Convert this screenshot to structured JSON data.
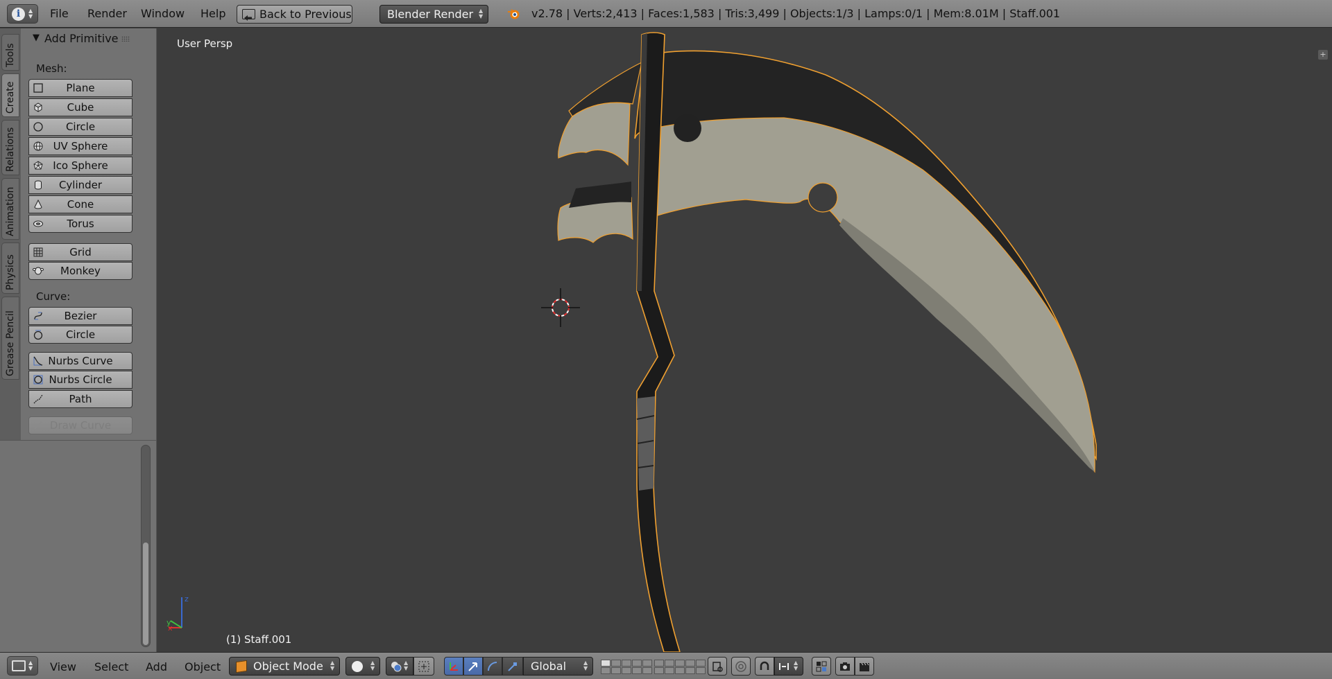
{
  "topbar": {
    "menus": [
      "File",
      "Render",
      "Window",
      "Help"
    ],
    "back_label": "Back to Previous",
    "render_engine": "Blender Render",
    "stats": "v2.78 | Verts:2,413 | Faces:1,583 | Tris:3,499 | Objects:1/3 | Lamps:0/1 | Mem:8.01M | Staff.001"
  },
  "tabs": [
    "Tools",
    "Create",
    "Relations",
    "Animation",
    "Physics",
    "Grease Pencil"
  ],
  "active_tab": "Create",
  "panel": {
    "title": "Add Primitive",
    "mesh_label": "Mesh:",
    "mesh_group1": [
      "Plane",
      "Cube",
      "Circle",
      "UV Sphere",
      "Ico Sphere",
      "Cylinder",
      "Cone",
      "Torus"
    ],
    "mesh_group2": [
      "Grid",
      "Monkey"
    ],
    "curve_label": "Curve:",
    "curve_group1": [
      "Bezier",
      "Circle"
    ],
    "curve_group2": [
      "Nurbs Curve",
      "Nurbs Circle",
      "Path"
    ],
    "draw_curve": "Draw Curve"
  },
  "viewport": {
    "view_label": "User Persp",
    "object_label": "(1) Staff.001"
  },
  "bottombar": {
    "menus": [
      "View",
      "Select",
      "Add",
      "Object"
    ],
    "mode": "Object Mode",
    "orientation": "Global"
  },
  "colors": {
    "viewport_bg": "#3d3d3d",
    "selection_outline": "#f0a030",
    "blade_light": "#a19f91",
    "blade_dark": "#222222"
  }
}
